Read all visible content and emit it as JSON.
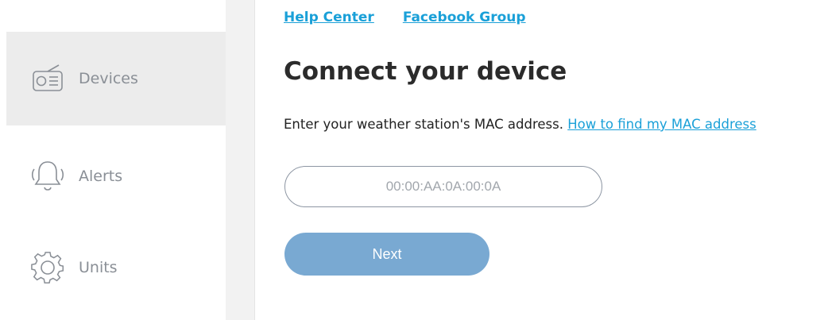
{
  "sidebar": {
    "items": [
      {
        "label": "Devices",
        "icon": "radio-icon",
        "active": true
      },
      {
        "label": "Alerts",
        "icon": "bell-ringing-icon",
        "active": false
      },
      {
        "label": "Units",
        "icon": "gear-icon",
        "active": false
      }
    ]
  },
  "header": {
    "links": [
      {
        "label": "Help Center"
      },
      {
        "label": "Facebook Group"
      }
    ]
  },
  "main": {
    "title": "Connect your device",
    "instruction": "Enter your weather station's MAC address.",
    "help_link": "How to find my MAC address",
    "mac_input": {
      "value": "",
      "placeholder": "00:00:AA:0A:00:0A"
    },
    "next_label": "Next"
  },
  "colors": {
    "link": "#1aa0d8",
    "button": "#79a9d2",
    "active_sidebar": "#ececec",
    "sidebar_text": "#8a8f96"
  }
}
